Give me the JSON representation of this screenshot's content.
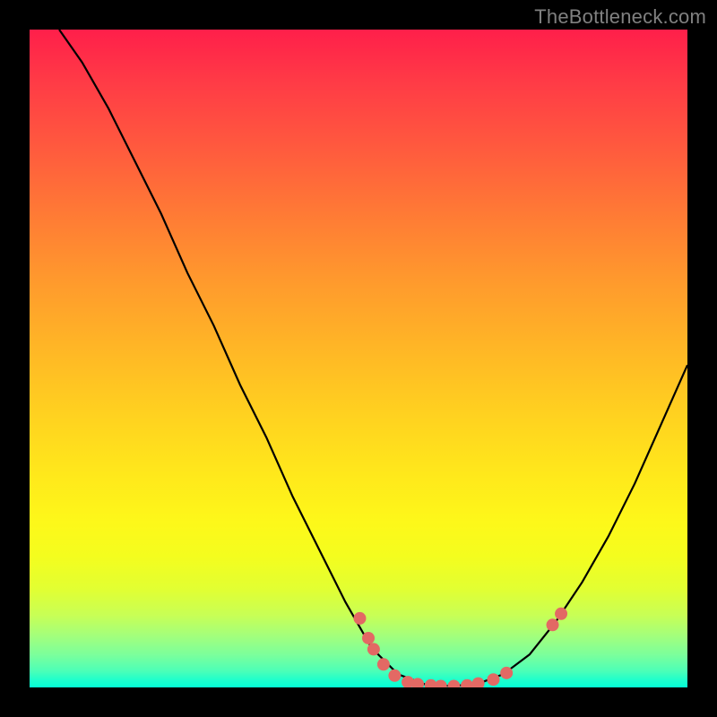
{
  "watermark": "TheBottleneck.com",
  "chart_data": {
    "type": "line",
    "xlim": [
      0,
      100
    ],
    "ylim": [
      0,
      100
    ],
    "curve": [
      {
        "x": 4.5,
        "y": 100
      },
      {
        "x": 8,
        "y": 95
      },
      {
        "x": 12,
        "y": 88
      },
      {
        "x": 16,
        "y": 80
      },
      {
        "x": 20,
        "y": 72
      },
      {
        "x": 24,
        "y": 63
      },
      {
        "x": 28,
        "y": 55
      },
      {
        "x": 32,
        "y": 46
      },
      {
        "x": 36,
        "y": 38
      },
      {
        "x": 40,
        "y": 29
      },
      {
        "x": 44,
        "y": 21
      },
      {
        "x": 48,
        "y": 13
      },
      {
        "x": 52,
        "y": 6
      },
      {
        "x": 56,
        "y": 2
      },
      {
        "x": 60,
        "y": 0.5
      },
      {
        "x": 64,
        "y": 0.2
      },
      {
        "x": 68,
        "y": 0.5
      },
      {
        "x": 72,
        "y": 2
      },
      {
        "x": 76,
        "y": 5
      },
      {
        "x": 80,
        "y": 10
      },
      {
        "x": 84,
        "y": 16
      },
      {
        "x": 88,
        "y": 23
      },
      {
        "x": 92,
        "y": 31
      },
      {
        "x": 96,
        "y": 40
      },
      {
        "x": 100,
        "y": 49
      }
    ],
    "points": [
      {
        "x": 50.2,
        "y": 10.5
      },
      {
        "x": 51.5,
        "y": 7.5
      },
      {
        "x": 52.3,
        "y": 5.8
      },
      {
        "x": 53.8,
        "y": 3.5
      },
      {
        "x": 55.5,
        "y": 1.8
      },
      {
        "x": 57.5,
        "y": 0.8
      },
      {
        "x": 59.0,
        "y": 0.5
      },
      {
        "x": 61.0,
        "y": 0.3
      },
      {
        "x": 62.5,
        "y": 0.2
      },
      {
        "x": 64.5,
        "y": 0.2
      },
      {
        "x": 66.5,
        "y": 0.3
      },
      {
        "x": 68.2,
        "y": 0.6
      },
      {
        "x": 70.5,
        "y": 1.2
      },
      {
        "x": 72.5,
        "y": 2.2
      },
      {
        "x": 79.5,
        "y": 9.5
      },
      {
        "x": 80.8,
        "y": 11.2
      }
    ],
    "marker_color": "#e36964",
    "line_color": "#000000",
    "marker_radius_px": 7
  }
}
